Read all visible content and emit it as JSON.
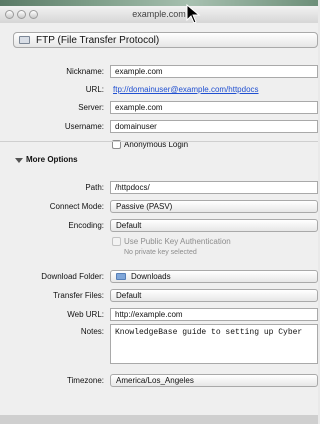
{
  "window": {
    "title": "example.com"
  },
  "protocol": {
    "label": "FTP (File Transfer Protocol)"
  },
  "labels": {
    "nickname": "Nickname:",
    "url": "URL:",
    "server": "Server:",
    "username": "Username:",
    "path": "Path:",
    "connect_mode": "Connect Mode:",
    "encoding": "Encoding:",
    "download_folder": "Download Folder:",
    "transfer_files": "Transfer Files:",
    "web_url": "Web URL:",
    "notes": "Notes:",
    "timezone": "Timezone:"
  },
  "fields": {
    "nickname": "example.com",
    "url": "ftp://domainuser@example.com/httpdocs",
    "server": "example.com",
    "username": "domainuser",
    "path": "/httpdocs/",
    "web_url": "http://example.com",
    "notes": "KnowledgeBase guide to setting up Cyber"
  },
  "checkboxes": {
    "anonymous_login": "Anonymous Login",
    "public_key_auth": "Use Public Key Authentication",
    "public_key_note": "No private key selected"
  },
  "section": {
    "more_options": "More Options"
  },
  "popups": {
    "connect_mode": "Passive (PASV)",
    "encoding": "Default",
    "download_folder": "Downloads",
    "transfer_files": "Default",
    "timezone": "America/Los_Angeles"
  },
  "icons": {
    "traffic_lights": "window-buttons",
    "protocol": "ftp-icon",
    "folder": "folder-icon",
    "disclosure": "disclosure-triangle"
  }
}
